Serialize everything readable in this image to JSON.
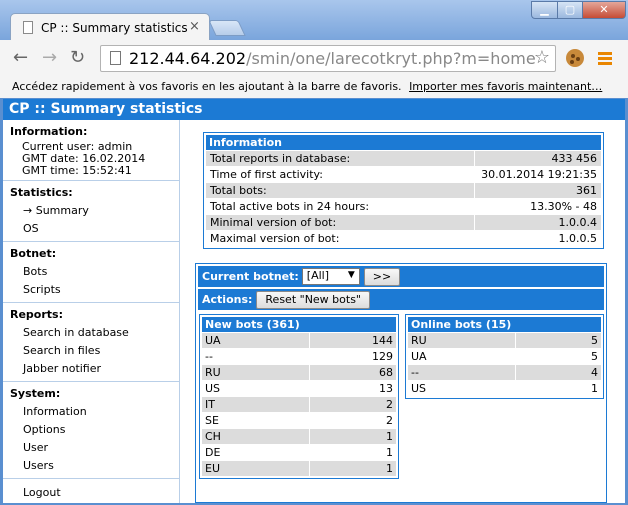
{
  "browser": {
    "tab_title": "CP :: Summary statistics",
    "tab_close": "×",
    "url_host": "212.44.64.202",
    "url_path": "/smin/one/larecotkryt.php?m=home",
    "bookmarks_text": "Accédez rapidement à vos favoris en les ajoutant à la barre de favoris.",
    "bookmarks_link": "Importer mes favoris maintenant…"
  },
  "header": {
    "title": "CP :: Summary statistics"
  },
  "sidebar": {
    "information": {
      "heading": "Information:",
      "lines": [
        "Current user: admin",
        "GMT date: 16.02.2014",
        "GMT time: 15:52:41"
      ]
    },
    "statistics": {
      "heading": "Statistics:",
      "items": [
        "→ Summary",
        "OS"
      ]
    },
    "botnet": {
      "heading": "Botnet:",
      "items": [
        "Bots",
        "Scripts"
      ]
    },
    "reports": {
      "heading": "Reports:",
      "items": [
        "Search in database",
        "Search in files",
        "Jabber notifier"
      ]
    },
    "system": {
      "heading": "System:",
      "items": [
        "Information",
        "Options",
        "User",
        "Users"
      ]
    },
    "logout": "Logout"
  },
  "info": {
    "heading": "Information",
    "rows": [
      {
        "label": "Total reports in database:",
        "value": "433 456"
      },
      {
        "label": "Time of first activity:",
        "value": "30.01.2014 19:21:35"
      },
      {
        "label": "Total bots:",
        "value": "361"
      },
      {
        "label": "Total active bots in 24 hours:",
        "value": "13.30% - 48"
      },
      {
        "label": "Minimal version of bot:",
        "value": "1.0.0.4"
      },
      {
        "label": "Maximal version of bot:",
        "value": "1.0.0.5"
      }
    ]
  },
  "botnet": {
    "current_label": "Current botnet:",
    "select_value": "[All]",
    "go_button": ">>",
    "actions_label": "Actions:",
    "reset_button": "Reset \"New bots\""
  },
  "new_bots": {
    "heading": "New bots (361)",
    "rows": [
      {
        "country": "UA",
        "count": "144"
      },
      {
        "country": "--",
        "count": "129"
      },
      {
        "country": "RU",
        "count": "68"
      },
      {
        "country": "US",
        "count": "13"
      },
      {
        "country": "IT",
        "count": "2"
      },
      {
        "country": "SE",
        "count": "2"
      },
      {
        "country": "CH",
        "count": "1"
      },
      {
        "country": "DE",
        "count": "1"
      },
      {
        "country": "EU",
        "count": "1"
      }
    ]
  },
  "online_bots": {
    "heading": "Online bots (15)",
    "rows": [
      {
        "country": "RU",
        "count": "5"
      },
      {
        "country": "UA",
        "count": "5"
      },
      {
        "country": "--",
        "count": "4"
      },
      {
        "country": "US",
        "count": "1"
      }
    ]
  }
}
